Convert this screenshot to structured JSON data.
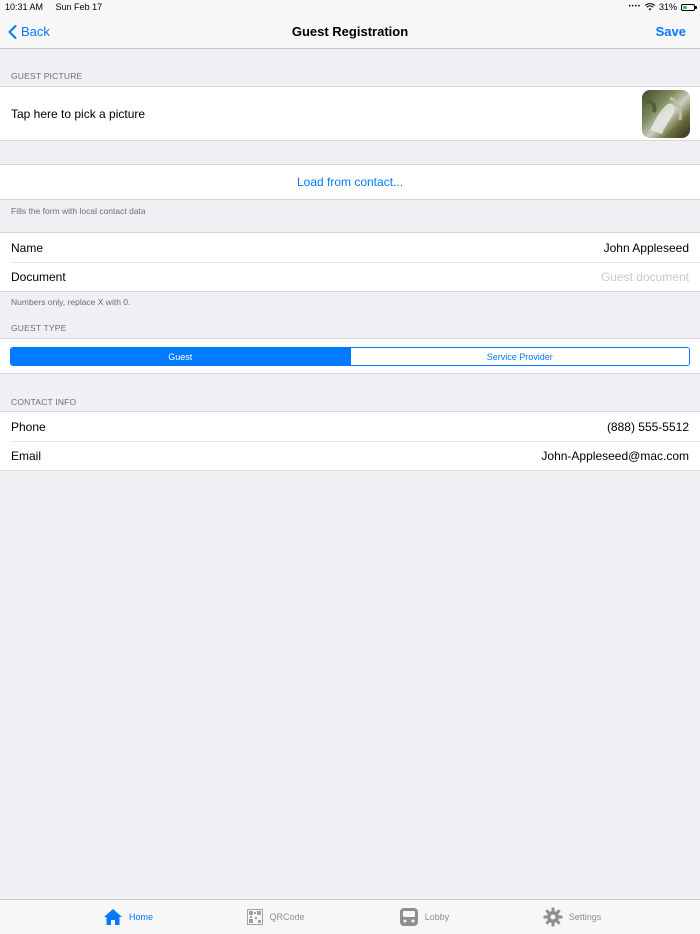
{
  "status_bar": {
    "time": "10:31 AM",
    "date": "Sun Feb 17",
    "battery": "31%",
    "battery_level": 0.31
  },
  "nav": {
    "back_label": "Back",
    "title": "Guest Registration",
    "save_label": "Save"
  },
  "guest_picture": {
    "header": "GUEST PICTURE",
    "tap_label": "Tap here to pick a picture"
  },
  "load_contact": {
    "button_label": "Load from contact...",
    "footer": "Fills the form with local contact data"
  },
  "identity": {
    "name_label": "Name",
    "name_value": "John Appleseed",
    "document_label": "Document",
    "document_placeholder": "Guest document",
    "footer": "Numbers only, replace X with 0."
  },
  "guest_type": {
    "header": "GUEST TYPE",
    "options": [
      "Guest",
      "Service Provider"
    ],
    "selected": "Guest"
  },
  "contact_info": {
    "header": "CONTACT INFO",
    "phone_label": "Phone",
    "phone_value": "(888) 555-5512",
    "email_label": "Email",
    "email_value": "John-Appleseed@mac.com"
  },
  "tabs": [
    {
      "label": "Home",
      "icon": "home-icon",
      "active": true
    },
    {
      "label": "QRCode",
      "icon": "qrcode-icon",
      "active": false
    },
    {
      "label": "Lobby",
      "icon": "bus-icon",
      "active": false
    },
    {
      "label": "Settings",
      "icon": "gear-icon",
      "active": false
    }
  ],
  "colors": {
    "accent": "#007aff",
    "background": "#efeff4",
    "inactive_tab": "#8e8e93"
  }
}
